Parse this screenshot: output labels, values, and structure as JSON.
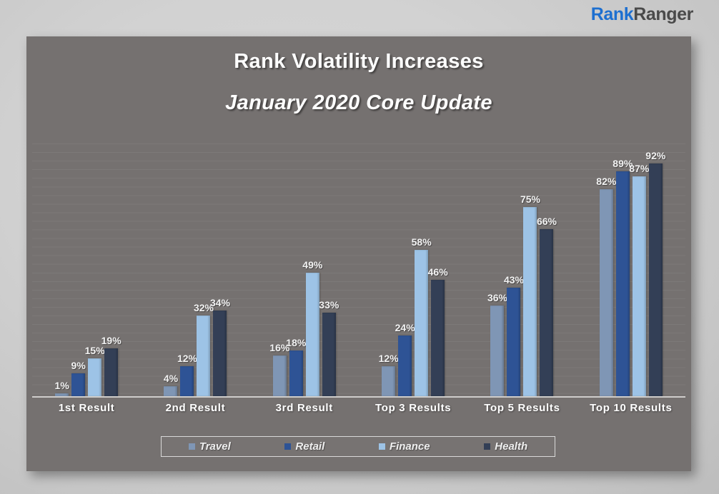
{
  "brand": {
    "part1": "Rank",
    "part2": "Ranger"
  },
  "chart_data": {
    "type": "bar",
    "title": "Rank Volatility Increases",
    "subtitle": "January 2020 Core Update",
    "xlabel": "",
    "ylabel": "",
    "ylim": [
      0,
      100
    ],
    "grid": true,
    "legend_position": "bottom",
    "value_suffix": "%",
    "categories": [
      "1st Result",
      "2nd Result",
      "3rd Result",
      "Top 3 Results",
      "Top 5 Results",
      "Top 10 Results"
    ],
    "series": [
      {
        "name": "Travel",
        "color": "#7f96b5",
        "values": [
          1,
          4,
          16,
          12,
          36,
          82
        ],
        "labels": [
          "1%",
          "4%",
          "16%",
          "12%",
          "36%",
          "82%"
        ]
      },
      {
        "name": "Retail",
        "color": "#2e5395",
        "values": [
          9,
          12,
          18,
          24,
          43,
          89
        ],
        "labels": [
          "9%",
          "12%",
          "18%",
          "24%",
          "43%",
          "89%"
        ]
      },
      {
        "name": "Finance",
        "color": "#9dc3e6",
        "values": [
          15,
          32,
          49,
          58,
          75,
          87
        ],
        "labels": [
          "15%",
          "32%",
          "49%",
          "58%",
          "75%",
          "87%"
        ]
      },
      {
        "name": "Health",
        "color": "#333f56",
        "values": [
          19,
          34,
          33,
          46,
          66,
          92
        ],
        "labels": [
          "19%",
          "34%",
          "33%",
          "46%",
          "66%",
          "92%"
        ]
      }
    ]
  },
  "colors": {
    "page_background": "#d2d2d2",
    "panel_background": "#757170",
    "axis_line": "#cfcdcb",
    "label_text": "#ffffff",
    "brand_accent": "#1d6fd0",
    "brand_dark": "#4a4a4a"
  }
}
